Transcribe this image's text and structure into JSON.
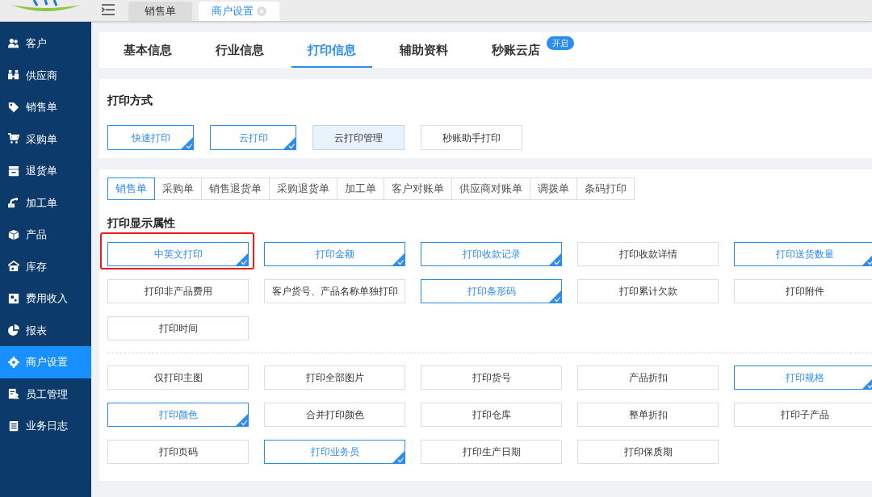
{
  "top_tabs": [
    {
      "label": "销售单",
      "selected": false
    },
    {
      "label": "商户设置",
      "selected": true
    }
  ],
  "sidebar": {
    "items": [
      {
        "label": "客户",
        "selected": false
      },
      {
        "label": "供应商",
        "selected": false
      },
      {
        "label": "销售单",
        "selected": false
      },
      {
        "label": "采购单",
        "selected": false
      },
      {
        "label": "退货单",
        "selected": false
      },
      {
        "label": "加工单",
        "selected": false
      },
      {
        "label": "产品",
        "selected": false
      },
      {
        "label": "库存",
        "selected": false
      },
      {
        "label": "费用收入",
        "selected": false
      },
      {
        "label": "报表",
        "selected": false
      },
      {
        "label": "商户设置",
        "selected": true
      },
      {
        "label": "员工管理",
        "selected": false
      },
      {
        "label": "业务日志",
        "selected": false
      }
    ]
  },
  "settings_tabs": [
    {
      "label": "基本信息",
      "selected": false
    },
    {
      "label": "行业信息",
      "selected": false
    },
    {
      "label": "打印信息",
      "selected": true
    },
    {
      "label": "辅助资料",
      "selected": false
    },
    {
      "label": "秒账云店",
      "selected": false,
      "badge": "开启"
    }
  ],
  "print_method": {
    "title": "打印方式",
    "buttons": [
      {
        "kind": "toggle",
        "label": "快速打印",
        "checked": true
      },
      {
        "kind": "toggle",
        "label": "云打印",
        "checked": true
      },
      {
        "kind": "tinted",
        "label": "云打印管理"
      },
      {
        "kind": "plain",
        "label": "秒账助手打印"
      }
    ]
  },
  "document_tabs": [
    {
      "label": "销售单",
      "selected": true
    },
    {
      "label": "采购单",
      "selected": false
    },
    {
      "label": "销售退货单",
      "selected": false
    },
    {
      "label": "采购退货单",
      "selected": false
    },
    {
      "label": "加工单",
      "selected": false
    },
    {
      "label": "客户对账单",
      "selected": false
    },
    {
      "label": "供应商对账单",
      "selected": false
    },
    {
      "label": "调拨单",
      "selected": false
    },
    {
      "label": "条码打印",
      "selected": false
    }
  ],
  "display_properties": {
    "title": "打印显示属性",
    "groups": [
      [
        {
          "label": "中英文打印",
          "checked": true,
          "highlighted": true
        },
        {
          "label": "打印金额",
          "checked": true,
          "highlighted": false
        },
        {
          "label": "打印收款记录",
          "checked": true,
          "highlighted": false
        },
        {
          "label": "打印收款详情",
          "checked": false,
          "highlighted": false
        },
        {
          "label": "打印送货数量",
          "checked": true,
          "highlighted": false
        },
        {
          "label": "打印非产品费用",
          "checked": false,
          "highlighted": false
        },
        {
          "label": "客户货号、产品名称单独打印",
          "checked": false,
          "highlighted": false
        },
        {
          "label": "打印条形码",
          "checked": true,
          "highlighted": false
        },
        {
          "label": "打印累计欠款",
          "checked": false,
          "highlighted": false
        },
        {
          "label": "打印附件",
          "checked": false,
          "highlighted": false
        },
        {
          "label": "打印时间",
          "checked": false,
          "highlighted": false
        }
      ],
      [
        {
          "label": "仅打印主图",
          "checked": false,
          "highlighted": false
        },
        {
          "label": "打印全部图片",
          "checked": false,
          "highlighted": false
        },
        {
          "label": "打印货号",
          "checked": false,
          "highlighted": false
        },
        {
          "label": "产品折扣",
          "checked": false,
          "highlighted": false
        },
        {
          "label": "打印规格",
          "checked": true,
          "highlighted": false
        },
        {
          "label": "打印颜色",
          "checked": true,
          "highlighted": false
        },
        {
          "label": "合并打印颜色",
          "checked": false,
          "highlighted": false
        },
        {
          "label": "打印仓库",
          "checked": false,
          "highlighted": false
        },
        {
          "label": "整单折扣",
          "checked": false,
          "highlighted": false
        },
        {
          "label": "打印子产品",
          "checked": false,
          "highlighted": false
        },
        {
          "label": "打印页码",
          "checked": false,
          "highlighted": false
        },
        {
          "label": "打印业务员",
          "checked": true,
          "highlighted": false
        },
        {
          "label": "打印生产日期",
          "checked": false,
          "highlighted": false
        },
        {
          "label": "打印保质期",
          "checked": false,
          "highlighted": false
        }
      ]
    ]
  }
}
